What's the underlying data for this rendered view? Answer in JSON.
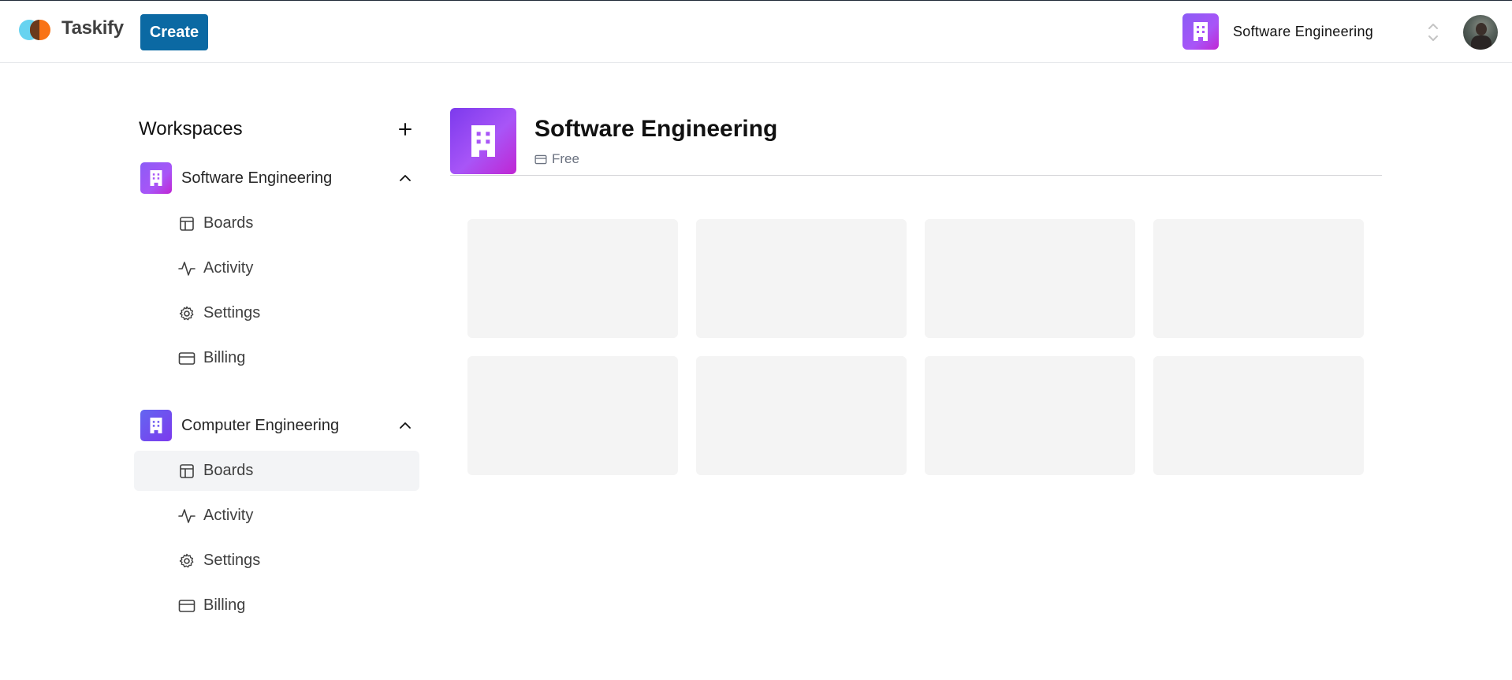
{
  "app": {
    "name": "Taskify"
  },
  "header": {
    "create_label": "Create",
    "current_workspace": "Software Engineering"
  },
  "sidebar": {
    "title": "Workspaces",
    "workspaces": [
      {
        "name": "Software Engineering",
        "expanded": true,
        "items": [
          {
            "label": "Boards",
            "icon": "layout-icon",
            "active": false
          },
          {
            "label": "Activity",
            "icon": "activity-icon",
            "active": false
          },
          {
            "label": "Settings",
            "icon": "gear-icon",
            "active": false
          },
          {
            "label": "Billing",
            "icon": "credit-card-icon",
            "active": false
          }
        ]
      },
      {
        "name": "Computer Engineering",
        "expanded": true,
        "items": [
          {
            "label": "Boards",
            "icon": "layout-icon",
            "active": true
          },
          {
            "label": "Activity",
            "icon": "activity-icon",
            "active": false
          },
          {
            "label": "Settings",
            "icon": "gear-icon",
            "active": false
          },
          {
            "label": "Billing",
            "icon": "credit-card-icon",
            "active": false
          }
        ]
      }
    ]
  },
  "main": {
    "title": "Software Engineering",
    "plan": "Free",
    "loading_cards": 8
  },
  "colors": {
    "accent": "#0b69a3",
    "badge_purple": "#a855f7",
    "badge_indigo": "#6366f1",
    "skeleton": "#f4f4f4",
    "active_item_bg": "#f3f4f6"
  }
}
